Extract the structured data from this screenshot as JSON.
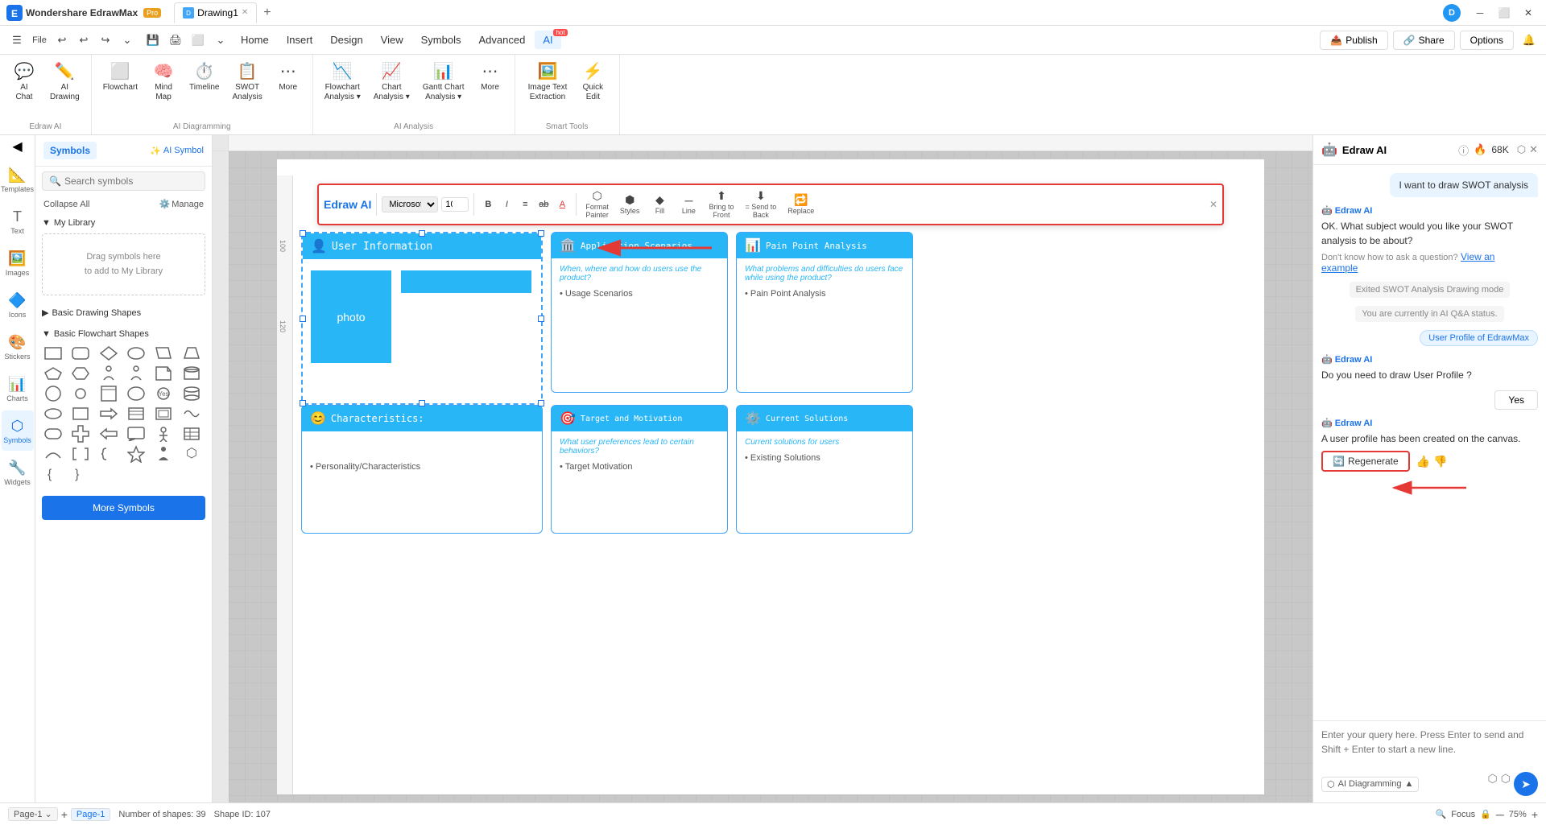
{
  "titlebar": {
    "app_name": "Wondershare EdrawMax",
    "pro_badge": "Pro",
    "tabs": [
      {
        "label": "Drawing1",
        "active": true
      }
    ],
    "window_controls": [
      "─",
      "□",
      "✕"
    ],
    "avatar_letter": "D"
  },
  "menubar": {
    "items": [
      "File",
      "Home",
      "Insert",
      "Design",
      "View",
      "Symbols",
      "Advanced",
      "AI"
    ],
    "ai_hot": "hot",
    "right_actions": {
      "publish": "Publish",
      "share": "Share",
      "options": "Options"
    }
  },
  "ribbon": {
    "groups": [
      {
        "id": "ai_basic",
        "label": "Edraw AI",
        "items": [
          {
            "icon": "💬",
            "label": "AI Chat"
          },
          {
            "icon": "✏️",
            "label": "AI Drawing"
          }
        ]
      },
      {
        "id": "ai_diagramming",
        "label": "AI Diagramming",
        "items": [
          {
            "icon": "📊",
            "label": "Flowchart"
          },
          {
            "icon": "🧠",
            "label": "Mind Map"
          },
          {
            "icon": "⏱️",
            "label": "Timeline"
          },
          {
            "icon": "📋",
            "label": "SWOT Analysis"
          },
          {
            "icon": "⋯",
            "label": "More"
          }
        ]
      },
      {
        "id": "ai_analysis",
        "label": "AI Analysis",
        "items": [
          {
            "icon": "📉",
            "label": "Flowchart Analysis"
          },
          {
            "icon": "📈",
            "label": "Chart Analysis"
          },
          {
            "icon": "📊",
            "label": "Gantt Chart Analysis"
          },
          {
            "icon": "⋯",
            "label": "More"
          }
        ]
      },
      {
        "id": "smart_tools",
        "label": "Smart Tools",
        "items": [
          {
            "icon": "🖼️",
            "label": "Image Text Extraction"
          },
          {
            "icon": "⚡",
            "label": "Quick Edit"
          }
        ]
      }
    ]
  },
  "left_nav": {
    "items": [
      {
        "icon": "📐",
        "label": "Templates",
        "active": false
      },
      {
        "icon": "✏️",
        "label": "Text",
        "active": false
      },
      {
        "icon": "🖼️",
        "label": "Images",
        "active": false
      },
      {
        "icon": "🔷",
        "label": "Icons",
        "active": false
      },
      {
        "icon": "🎨",
        "label": "Stickers",
        "active": false
      },
      {
        "icon": "📊",
        "label": "Charts",
        "active": false
      },
      {
        "icon": "🔧",
        "label": "Widgets",
        "active": false
      },
      {
        "icon": "⬡",
        "label": "Symbols",
        "active": true
      }
    ]
  },
  "left_sidebar": {
    "tabs": [
      {
        "label": "Symbols",
        "active": true
      },
      {
        "label": "AI Symbol",
        "active": false
      }
    ],
    "search_placeholder": "Search symbols",
    "collapse_all": "Collapse All",
    "manage": "Manage",
    "my_library": "My Library",
    "library_drag_text": "Drag symbols here\nto add to My Library",
    "basic_shapes": "Basic Drawing Shapes",
    "flowchart_shapes": "Basic Flowchart Shapes",
    "more_symbols_btn": "More Symbols"
  },
  "float_toolbar": {
    "logo": "Edraw AI",
    "font_family": "Microsof",
    "font_size": "10",
    "format_btns": [
      "B",
      "I",
      "≡",
      "ab",
      "A"
    ],
    "items": [
      {
        "icon": "⬡",
        "label": "Format\nPainter"
      },
      {
        "icon": "⬢",
        "label": "Styles"
      },
      {
        "icon": "◆",
        "label": "Fill"
      },
      {
        "icon": "─",
        "label": "Line"
      },
      {
        "icon": "⬆",
        "label": "Bring to\nFront"
      },
      {
        "icon": "⬇",
        "label": "Send to\nBack"
      },
      {
        "icon": "🔁",
        "label": "Replace"
      }
    ]
  },
  "diagram": {
    "cards": [
      {
        "id": "user-info",
        "title": "User Information",
        "icon": "👤",
        "photo_label": "photo"
      },
      {
        "id": "app-scenarios",
        "title": "Application Scenarios",
        "icon": "🏛️",
        "subtitle": "When, where and how do users use the product?",
        "bullets": [
          "Usage Scenarios"
        ]
      },
      {
        "id": "pain-point",
        "title": "Pain Point Analysis",
        "icon": "📊",
        "subtitle": "What problems and difficulties do users face while using the product?",
        "bullets": [
          "Pain Point Analysis"
        ]
      },
      {
        "id": "characteristics",
        "title": "Characteristics:",
        "icon": "😊",
        "bullets": [
          "Personality/Characteristics"
        ]
      },
      {
        "id": "target-motivation",
        "title": "Target and Motivation",
        "icon": "🎯",
        "subtitle": "What user preferences lead to certain behaviors?",
        "bullets": [
          "Target Motivation"
        ]
      },
      {
        "id": "current-solutions",
        "title": "Current Solutions",
        "icon": "⚙️",
        "subtitle": "Current solutions for users",
        "bullets": [
          "Existing Solutions"
        ]
      }
    ]
  },
  "right_panel": {
    "title": "Edraw AI",
    "flame_count": "68K",
    "chat": [
      {
        "type": "user",
        "text": "I want to draw SWOT analysis"
      },
      {
        "type": "ai",
        "text": "OK. What subject would you like your SWOT analysis to be about?"
      },
      {
        "type": "ai_sub",
        "text": "Don't know how to ask a question?",
        "link": "View an example"
      },
      {
        "type": "status",
        "text": "Exited SWOT Analysis Drawing mode"
      },
      {
        "type": "status",
        "text": "You are currently in AI Q&A status."
      },
      {
        "type": "action_btn",
        "text": "User Profile of EdrawMax"
      },
      {
        "type": "ai_msg2",
        "text": "Do you need to draw User Profile ?"
      },
      {
        "type": "yes_btn",
        "text": "Yes"
      },
      {
        "type": "ai_msg3",
        "text": "A user profile has been created on the canvas."
      }
    ],
    "regenerate_btn": "Regenerate",
    "input_placeholder": "Enter your query here. Press Enter to send and Shift + Enter to start a new line.",
    "mode_selector": "AI Diagramming"
  },
  "statusbar": {
    "page_label": "Page-1",
    "active_page": "Page-1",
    "shapes_count": "Number of shapes: 39",
    "shape_id": "Shape ID: 107",
    "focus": "Focus",
    "zoom": "75%"
  },
  "colors": {
    "primary": "#1a73e8",
    "accent_blue": "#29b6f6",
    "red_border": "#e53935",
    "ai_purple": "#7c4dff"
  }
}
